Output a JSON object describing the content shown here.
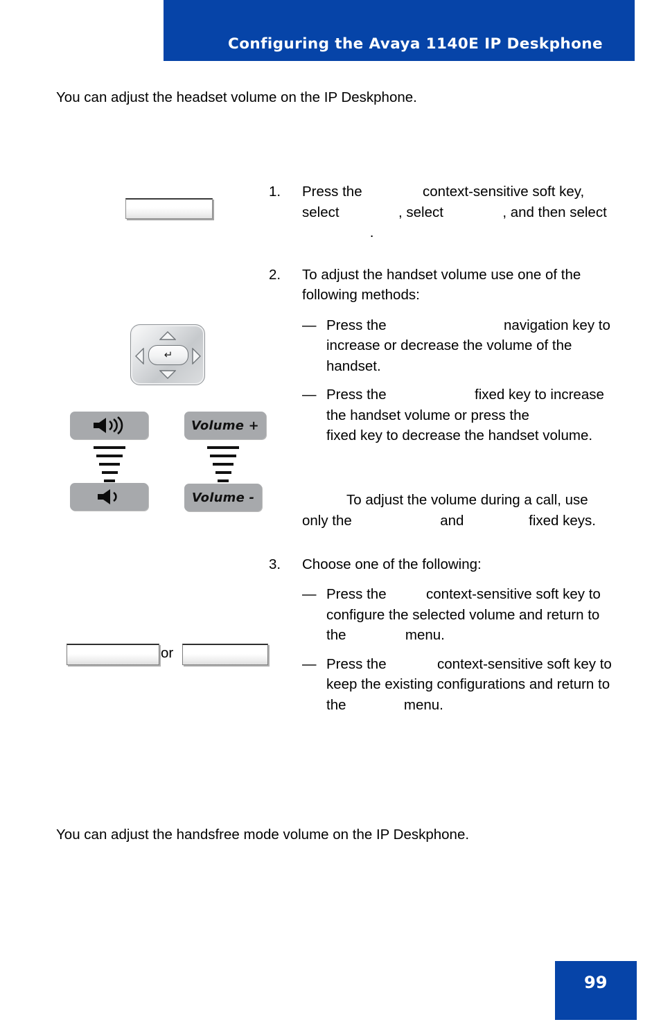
{
  "header": {
    "title": "Configuring the Avaya 1140E IP Deskphone",
    "band_color": "#0644A8"
  },
  "intro_paragraph": "You can adjust the headset volume on the IP Deskphone.",
  "closing_paragraph": "You can adjust the handsfree mode volume on the IP Deskphone.",
  "steps": [
    {
      "number": "1.",
      "text_parts": {
        "a": "Press the",
        "b": "context-sensitive soft key, select",
        "c": ", select",
        "d": ", and then select",
        "e": "."
      }
    },
    {
      "number": "2.",
      "text": "To adjust the handset volume use one of the following methods:",
      "sub_items": [
        {
          "dash": "—",
          "a": "Press the",
          "b": "navigation key to increase or decrease the volume of the handset."
        },
        {
          "dash": "—",
          "a": "Press the",
          "b": "fixed key to increase the handset volume or press the",
          "c": "fixed key to decrease the handset volume."
        }
      ]
    },
    {
      "number": "3.",
      "text": "Choose one of the following:",
      "sub_items": [
        {
          "dash": "—",
          "a": "Press the",
          "b": "context-sensitive soft key to configure the selected volume and return to the",
          "c": "menu."
        },
        {
          "dash": "—",
          "a": "Press the",
          "b": "context-sensitive soft key to keep the existing configurations and return to the",
          "c": "menu."
        }
      ]
    }
  ],
  "note": {
    "line1": "To adjust the volume during a call,",
    "line2": "use only the",
    "line3": "and",
    "line4": "fixed keys."
  },
  "graphics": {
    "softkey_blank_label": "",
    "or_label": "or",
    "nav_cluster": {
      "enter_glyph": "↵",
      "up_icon": "triangle-up-icon",
      "down_icon": "triangle-down-icon",
      "left_icon": "triangle-left-icon",
      "right_icon": "triangle-right-icon"
    },
    "volume_keys": {
      "speaker_loud_icon": "speaker-loud-icon",
      "speaker_quiet_icon": "speaker-quiet-icon",
      "volume_up_label": "Volume +",
      "volume_down_label": "Volume -",
      "key_color": "#a7a9ac"
    }
  },
  "page_number": "99"
}
